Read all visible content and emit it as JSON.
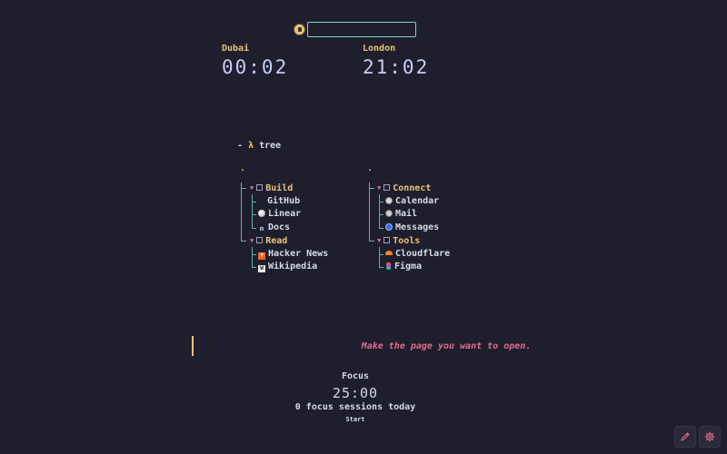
{
  "search": {
    "value": "",
    "placeholder": ""
  },
  "clocks": [
    {
      "city": "Dubai",
      "time": "00:02"
    },
    {
      "city": "London",
      "time": "21:02"
    }
  ],
  "tree": {
    "prompt": "-",
    "lambda": "λ",
    "command": "tree",
    "root_marker": ".",
    "left": {
      "folders": [
        {
          "label": "Build",
          "items": [
            {
              "label": "GitHub",
              "icon": "github-icon"
            },
            {
              "label": "Linear",
              "icon": "linear-icon"
            },
            {
              "label": "Docs",
              "icon": "docs-icon"
            }
          ]
        },
        {
          "label": "Read",
          "items": [
            {
              "label": "Hacker News",
              "icon": "hacker-news-icon"
            },
            {
              "label": "Wikipedia",
              "icon": "wikipedia-icon"
            }
          ]
        }
      ]
    },
    "right": {
      "folders": [
        {
          "label": "Connect",
          "items": [
            {
              "label": "Calendar",
              "icon": "calendar-icon"
            },
            {
              "label": "Mail",
              "icon": "mail-icon"
            },
            {
              "label": "Messages",
              "icon": "messages-icon"
            }
          ]
        },
        {
          "label": "Tools",
          "items": [
            {
              "label": "Cloudflare",
              "icon": "cloudflare-icon"
            },
            {
              "label": "Figma",
              "icon": "figma-icon"
            }
          ]
        }
      ]
    }
  },
  "message": "Make the page you want to open.",
  "focus": {
    "title": "Focus",
    "time": "25:00",
    "sessions": "0 focus sessions today",
    "start_label": "Start"
  },
  "colors": {
    "background": "#1f1e2c",
    "accent_yellow": "#e8c27a",
    "accent_pink": "#e06c8c",
    "accent_teal": "#58b6ad",
    "clock_text": "#c7cdf5"
  },
  "icons": {
    "edit": "pencil-icon",
    "settings": "gear-icon"
  }
}
